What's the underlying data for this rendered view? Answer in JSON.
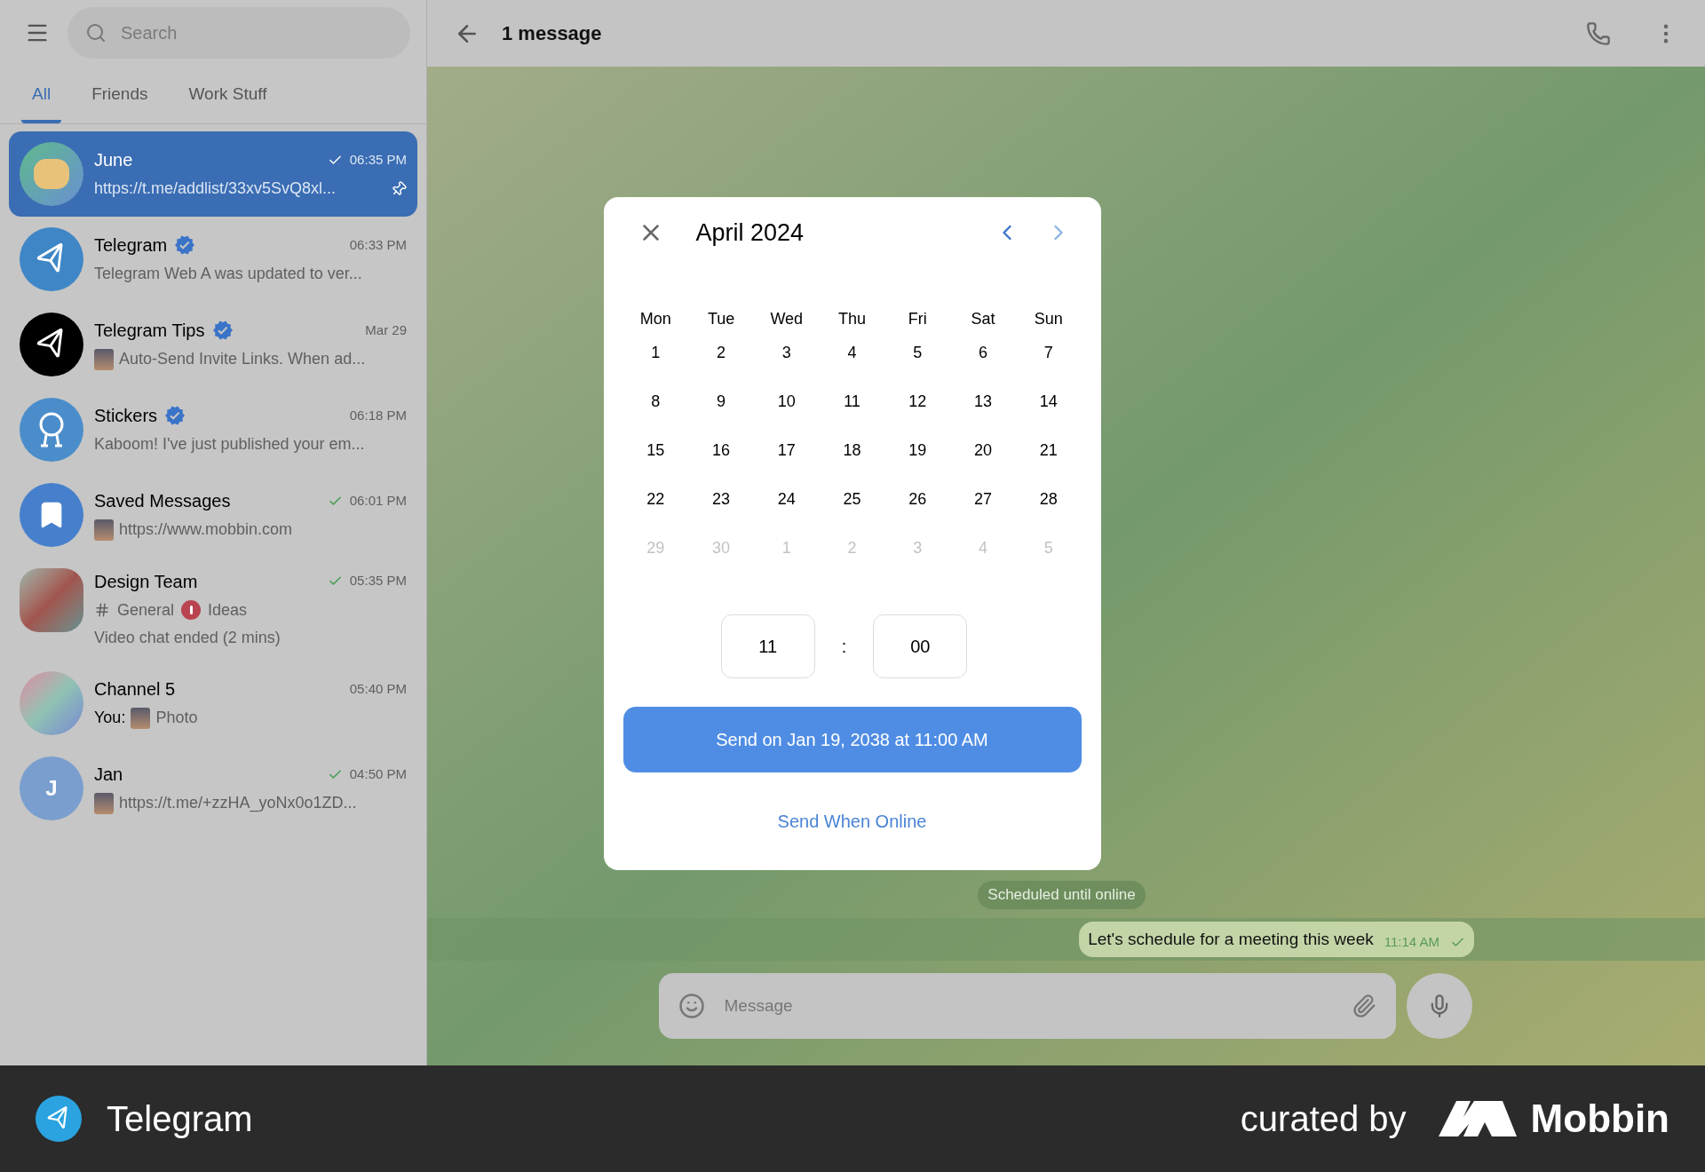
{
  "sidebar": {
    "search": {
      "placeholder": "Search"
    },
    "tabs": [
      {
        "label": "All",
        "selected": true
      },
      {
        "label": "Friends",
        "selected": false
      },
      {
        "label": "Work Stuff",
        "selected": false
      }
    ],
    "chats": [
      {
        "name": "June",
        "avatar": {
          "kind": "sticker"
        },
        "verified": false,
        "time": "06:35 PM",
        "read": true,
        "preview": "https://t.me/addlist/33xv5SvQ8xl...",
        "thumbnail": false,
        "pinned": true,
        "selected": true
      },
      {
        "name": "Telegram",
        "avatar": {
          "kind": "plane"
        },
        "verified": true,
        "time": "06:33 PM",
        "read": false,
        "preview": "Telegram Web A was updated to ver...",
        "thumbnail": false,
        "pinned": false,
        "selected": false
      },
      {
        "name": "Telegram Tips",
        "avatar": {
          "kind": "plane-dark"
        },
        "verified": true,
        "time": "Mar 29",
        "read": false,
        "preview": "Auto-Send Invite Links. When ad...",
        "thumbnail": true,
        "pinned": false,
        "selected": false
      },
      {
        "name": "Stickers",
        "avatar": {
          "kind": "duck"
        },
        "verified": true,
        "time": "06:18 PM",
        "read": false,
        "preview": "Kaboom! I've just published your em...",
        "thumbnail": false,
        "pinned": false,
        "selected": false
      },
      {
        "name": "Saved Messages",
        "avatar": {
          "kind": "bookmark"
        },
        "verified": false,
        "time": "06:01 PM",
        "read": true,
        "preview": "https://www.mobbin.com",
        "thumbnail": true,
        "pinned": false,
        "selected": false
      },
      {
        "name": "Design Team",
        "avatar": {
          "kind": "photo"
        },
        "verified": false,
        "time": "05:35 PM",
        "read": true,
        "topics": [
          "General",
          "Ideas"
        ],
        "preview": "Video chat ended (2 mins)",
        "thumbnail": false,
        "pinned": false,
        "selected": false
      },
      {
        "name": "Channel 5",
        "avatar": {
          "kind": "gradient"
        },
        "verified": false,
        "time": "05:40 PM",
        "read": false,
        "sender": "You:",
        "preview": "Photo",
        "thumbnail": true,
        "pinned": false,
        "selected": false
      },
      {
        "name": "Jan",
        "avatar": {
          "kind": "letter",
          "letter": "J"
        },
        "verified": false,
        "time": "04:50 PM",
        "read": true,
        "preview": "https://t.me/+zzHA_yoNx0o1ZD...",
        "thumbnail": true,
        "pinned": false,
        "selected": false
      }
    ]
  },
  "chat": {
    "title": "1 message",
    "service_pill": "Scheduled until online",
    "message": {
      "text": "Let's schedule for a meeting this week",
      "time": "11:14 AM",
      "read": true
    },
    "composer": {
      "placeholder": "Message"
    }
  },
  "dialog": {
    "title": "April 2024",
    "weekdays": [
      "Mon",
      "Tue",
      "Wed",
      "Thu",
      "Fri",
      "Sat",
      "Sun"
    ],
    "days": [
      {
        "label": "1",
        "muted": false
      },
      {
        "label": "2",
        "muted": false
      },
      {
        "label": "3",
        "muted": false
      },
      {
        "label": "4",
        "muted": false
      },
      {
        "label": "5",
        "muted": false
      },
      {
        "label": "6",
        "muted": false
      },
      {
        "label": "7",
        "muted": false
      },
      {
        "label": "8",
        "muted": false
      },
      {
        "label": "9",
        "muted": false
      },
      {
        "label": "10",
        "muted": false
      },
      {
        "label": "11",
        "muted": false
      },
      {
        "label": "12",
        "muted": false
      },
      {
        "label": "13",
        "muted": false
      },
      {
        "label": "14",
        "muted": false
      },
      {
        "label": "15",
        "muted": false
      },
      {
        "label": "16",
        "muted": false
      },
      {
        "label": "17",
        "muted": false
      },
      {
        "label": "18",
        "muted": false
      },
      {
        "label": "19",
        "muted": false
      },
      {
        "label": "20",
        "muted": false
      },
      {
        "label": "21",
        "muted": false
      },
      {
        "label": "22",
        "muted": false
      },
      {
        "label": "23",
        "muted": false
      },
      {
        "label": "24",
        "muted": false
      },
      {
        "label": "25",
        "muted": false
      },
      {
        "label": "26",
        "muted": false
      },
      {
        "label": "27",
        "muted": false
      },
      {
        "label": "28",
        "muted": false
      },
      {
        "label": "29",
        "muted": true
      },
      {
        "label": "30",
        "muted": true
      },
      {
        "label": "1",
        "muted": true
      },
      {
        "label": "2",
        "muted": true
      },
      {
        "label": "3",
        "muted": true
      },
      {
        "label": "4",
        "muted": true
      },
      {
        "label": "5",
        "muted": true
      }
    ],
    "hour": "11",
    "separator": ":",
    "minute": "00",
    "send_button": "Send on Jan 19, 2038 at 11:00 AM",
    "online_link": "Send When Online"
  },
  "footer": {
    "app": "Telegram",
    "curated": "curated by",
    "brand": "Mobbin"
  }
}
